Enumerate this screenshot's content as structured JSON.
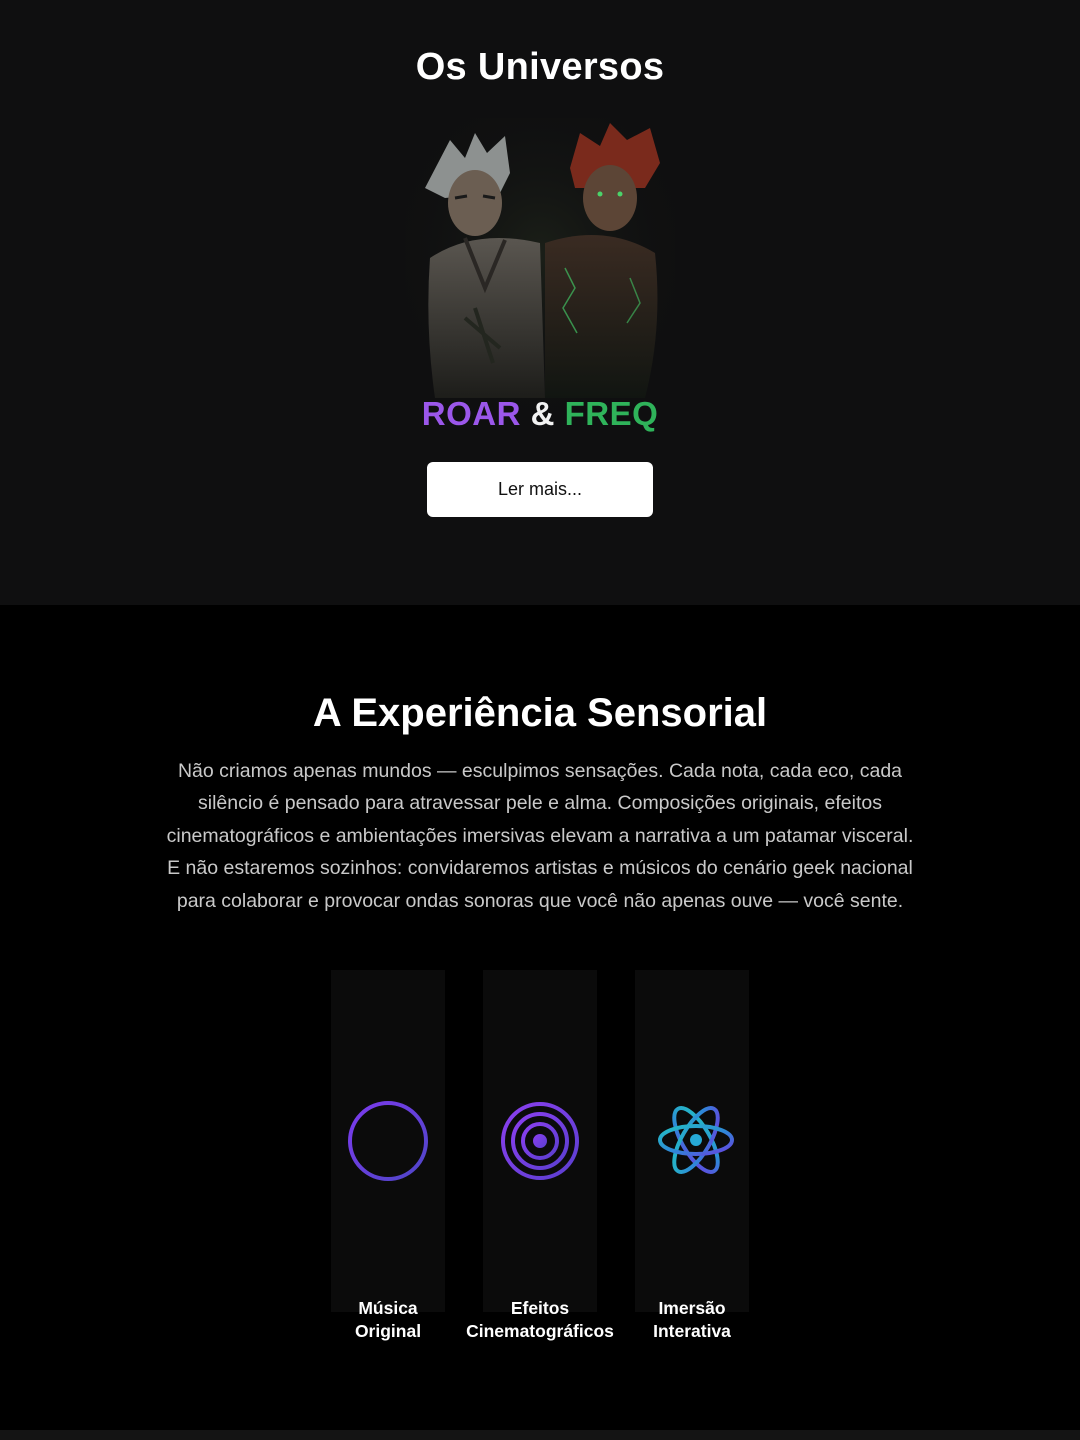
{
  "universes": {
    "title": "Os Universos",
    "logo": {
      "part1": "ROAR",
      "separator": "&",
      "part2": "FREQ"
    },
    "read_more_label": "Ler mais..."
  },
  "sensorial": {
    "title": "A Experiência Sensorial",
    "description": "Não criamos apenas mundos — esculpimos sensações. Cada nota, cada eco, cada silêncio é pensado para atravessar pele e alma. Composições originais, efeitos cinematográficos e ambientações imersivas elevam a narrativa a um patamar visceral. E não estaremos sozinhos: convidaremos artistas e músicos do cenário geek nacional para colaborar e provocar ondas sonoras que você não apenas ouve — você sente.",
    "features": [
      {
        "label_line1": "Música",
        "label_line2": "Original",
        "icon": "sound-wave-icon"
      },
      {
        "label_line1": "Efeitos",
        "label_line2": "Cinematográficos",
        "icon": "target-rings-icon"
      },
      {
        "label_line1": "Imersão",
        "label_line2": "Interativa",
        "icon": "atom-icon"
      }
    ]
  },
  "colors": {
    "roar": "#9b57ea",
    "freq": "#2fb35a",
    "icon_gradient_start": "#7c3aed",
    "icon_gradient_end": "#22c1c3"
  }
}
